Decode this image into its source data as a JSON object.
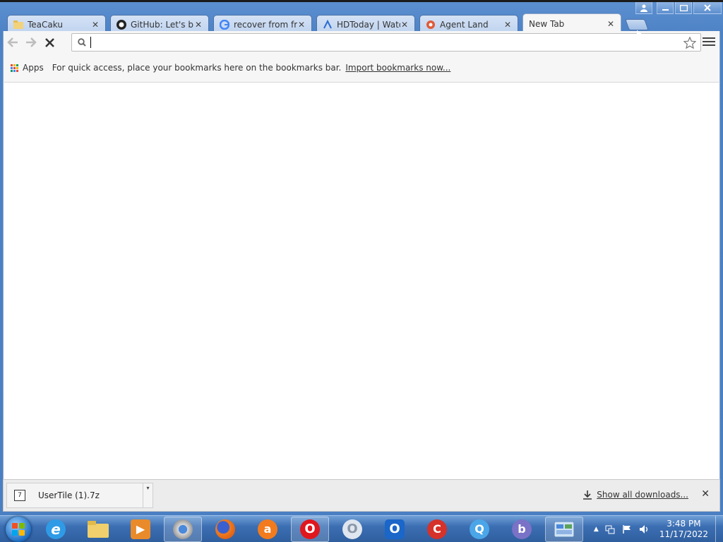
{
  "browser": {
    "tabs": [
      {
        "label": "TeaCaku",
        "icon": "folder-icon",
        "active": false
      },
      {
        "label": "GitHub: Let's buil",
        "icon": "github-icon",
        "active": false
      },
      {
        "label": "recover from frye",
        "icon": "google-icon",
        "active": false
      },
      {
        "label": "HDToday | Watc",
        "icon": "hdtoday-icon",
        "active": false
      },
      {
        "label": "Agent Land",
        "icon": "agentland-icon",
        "active": false
      },
      {
        "label": "New Tab",
        "icon": "",
        "active": true
      }
    ],
    "omnibox": {
      "value": "",
      "placeholder": ""
    },
    "bookmarks_bar": {
      "apps_label": "Apps",
      "message": "For quick access, place your bookmarks here on the bookmarks bar.",
      "import_link": "Import bookmarks now..."
    },
    "downloads": {
      "items": [
        {
          "filename": "UserTile (1).7z",
          "icon": "7z-file-icon"
        }
      ],
      "show_all_label": "Show all downloads..."
    }
  },
  "taskbar": {
    "apps": [
      {
        "name": "internet-explorer",
        "icon": "ie-icon"
      },
      {
        "name": "file-explorer",
        "icon": "folder-icon"
      },
      {
        "name": "media-player",
        "icon": "media-player-icon"
      },
      {
        "name": "chrome",
        "icon": "chrome-icon"
      },
      {
        "name": "firefox",
        "icon": "firefox-icon"
      },
      {
        "name": "avast",
        "icon": "avast-icon"
      },
      {
        "name": "opera",
        "icon": "opera-icon"
      },
      {
        "name": "opera-gx",
        "icon": "opera-white-icon"
      },
      {
        "name": "opera-blue",
        "icon": "opera-blue-icon"
      },
      {
        "name": "ccleaner",
        "icon": "ccleaner-icon"
      },
      {
        "name": "qbittorrent",
        "icon": "search-q-icon"
      },
      {
        "name": "bittorrent",
        "icon": "bittorrent-icon"
      },
      {
        "name": "control-panel",
        "icon": "control-panel-icon"
      }
    ],
    "clock": {
      "time": "3:48 PM",
      "date": "11/17/2022"
    }
  },
  "colors": {
    "accent": "#4a7fc2",
    "tab_bg": "#c9dbf2",
    "active_tab": "#f6f6f6",
    "taskbar": "#3c6eb3"
  }
}
